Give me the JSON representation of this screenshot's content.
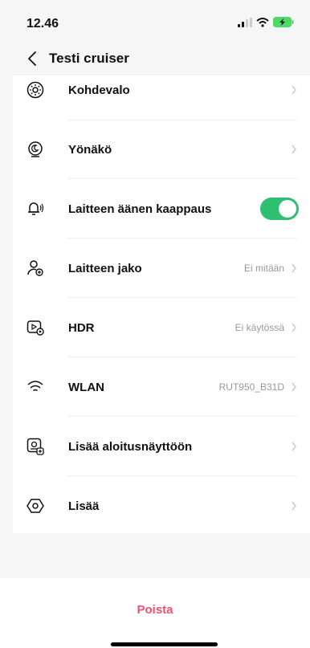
{
  "status_bar": {
    "time": "12.46"
  },
  "nav": {
    "title": "Testi cruiser"
  },
  "settings": [
    {
      "id": "kohdevalo",
      "label": "Kohdevalo",
      "value": "",
      "icon": "spotlight-icon"
    },
    {
      "id": "yonako",
      "label": "Yönäkö",
      "value": "",
      "icon": "night-vision-icon"
    },
    {
      "id": "aanen-kaappaus",
      "label": "Laitteen äänen kaappaus",
      "value": "",
      "icon": "bell-sound-icon",
      "toggle": true
    },
    {
      "id": "jako",
      "label": "Laitteen jako",
      "value": "Ei mitään",
      "icon": "share-user-icon"
    },
    {
      "id": "hdr",
      "label": "HDR",
      "value": "Ei käytössä",
      "icon": "hdr-icon"
    },
    {
      "id": "wlan",
      "label": "WLAN",
      "value": "RUT950_B31D",
      "icon": "wifi-icon"
    },
    {
      "id": "aloitusnaytto",
      "label": "Lisää aloitusnäyttöön",
      "value": "",
      "icon": "add-home-icon"
    },
    {
      "id": "lisaa",
      "label": "Lisää",
      "value": "",
      "icon": "hexagon-more-icon"
    }
  ],
  "footer": {
    "delete_label": "Poista"
  },
  "colors": {
    "accent": "#2fbf71",
    "danger": "#f0506e"
  }
}
